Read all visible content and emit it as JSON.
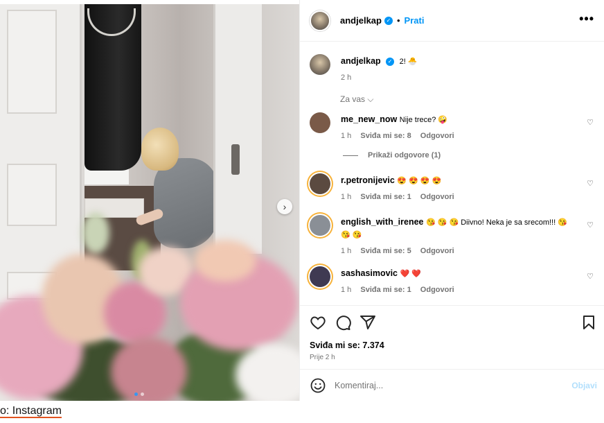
{
  "post": {
    "username": "andjelkap",
    "follow_label": "Prati",
    "separator": "•",
    "more_label": "•••"
  },
  "caption_comment": {
    "username": "andjelkap",
    "text": "2! 🐣",
    "time": "2 h"
  },
  "for_you_label": "Za vas ⌵",
  "comments": [
    {
      "username": "me_new_now",
      "text": "Nije trece? 🤪",
      "time": "1 h",
      "likes": "Sviđa mi se: 8",
      "reply": "Odgovori",
      "avatar_color": "#7a5a48"
    },
    {
      "username": "r.petronijevic",
      "text": "😍 😍 😍 😍",
      "time": "1 h",
      "likes": "Sviđa mi se: 1",
      "reply": "Odgovori",
      "avatar_color": "#5b4a40"
    },
    {
      "username": "english_with_irenee",
      "text": "😘 😘 😘 Diivno! Neka je sa srecom!!! 😘 😘 😘",
      "time": "1 h",
      "likes": "Sviđa mi se: 5",
      "reply": "Odgovori",
      "avatar_color": "#8a8f96"
    },
    {
      "username": "sashasimovic",
      "text": "❤️ ❤️",
      "time": "1 h",
      "likes": "Sviđa mi se: 1",
      "reply": "Odgovori",
      "avatar_color": "#3f3a52"
    }
  ],
  "show_replies_label": "Prikaži odgovore (1)",
  "likes_label": "Sviđa mi se: 7.374",
  "post_time": "Prije 2 h",
  "comment_input": {
    "placeholder": "Komentiraj...",
    "post_label": "Objavi"
  },
  "source_caption": "o: Instagram",
  "icons": {
    "like": "heart-icon",
    "comment": "comment-bubble-icon",
    "share": "paper-plane-icon",
    "save": "bookmark-icon",
    "emoji": "smiley-icon",
    "next": "chevron-right-icon"
  },
  "colors": {
    "link_blue": "#0095f6",
    "muted_text": "#737373",
    "disabled_post": "#b2dffc"
  }
}
